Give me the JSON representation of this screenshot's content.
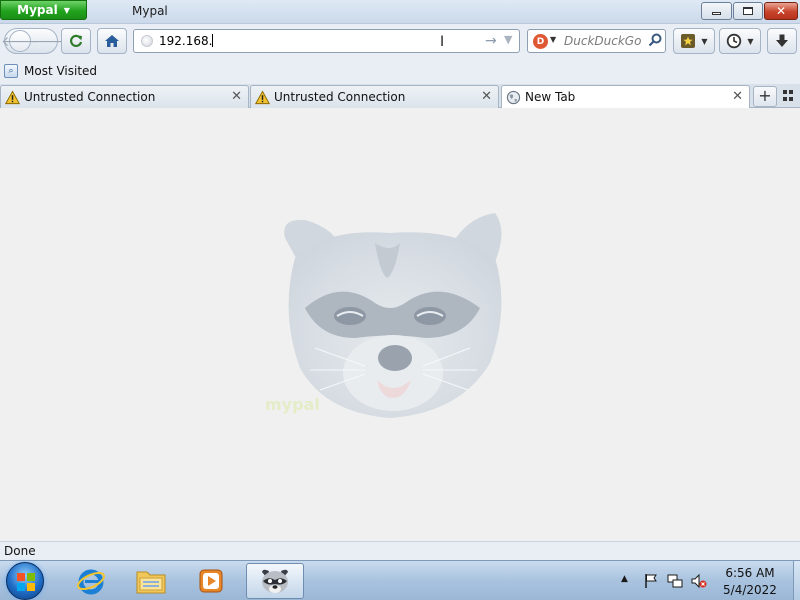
{
  "window": {
    "title": "Mypal",
    "app_menu_label": "Mypal"
  },
  "navbar": {
    "url_value": "192.168.",
    "search_engine": "DuckDuckGo",
    "search_placeholder": "DuckDuckGo"
  },
  "bookmarks_bar": {
    "items": [
      {
        "label": "Most Visited"
      }
    ]
  },
  "tabs": [
    {
      "label": "Untrusted Connection",
      "icon": "warning-icon",
      "active": false
    },
    {
      "label": "Untrusted Connection",
      "icon": "warning-icon",
      "active": false
    },
    {
      "label": "New Tab",
      "icon": "globe-icon",
      "active": true
    }
  ],
  "content": {
    "watermark_text": "mypal"
  },
  "status": {
    "text": "Done"
  },
  "taskbar": {
    "pinned": [
      {
        "name": "internet-explorer-icon"
      },
      {
        "name": "file-explorer-icon"
      },
      {
        "name": "media-player-icon"
      },
      {
        "name": "mypal-icon",
        "active": true
      }
    ],
    "clock_time": "6:56 AM",
    "clock_date": "5/4/2022"
  },
  "colors": {
    "accent_green": "#22a31e",
    "close_red": "#c8432b",
    "ddg_orange": "#de5833"
  }
}
